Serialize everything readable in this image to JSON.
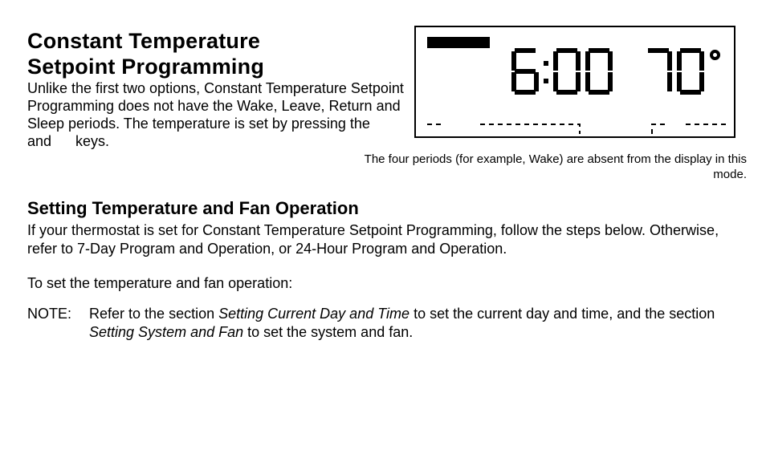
{
  "title_line1": "Constant Temperature",
  "title_line2": "Setpoint Programming",
  "intro": "Unlike the first two options, Constant Temperature Setpoint Programming does not have the Wake, Leave, Return and Sleep periods. The temperature is set by pressing the      and      keys.",
  "lcd": {
    "time": "6:00",
    "temperature": "70",
    "degree": "°"
  },
  "lcd_caption": "The four periods (for example, Wake) are absent from the display in this mode.",
  "section2_heading": "Setting Temperature and Fan Operation",
  "section2_p1": "If your thermostat is set for Constant Temperature Setpoint Programming, follow the steps below. Otherwise, refer to 7-Day Program and Operation, or 24-Hour Program and Operation.",
  "section2_p2": "To set the temperature and fan operation:",
  "note_label": "NOTE:",
  "note_pre": "Refer to the section ",
  "note_ref1": "Setting Current Day and Time",
  "note_mid": " to set the current day and time, and the section ",
  "note_ref2": "Setting System and Fan",
  "note_post": " to set the system and fan."
}
